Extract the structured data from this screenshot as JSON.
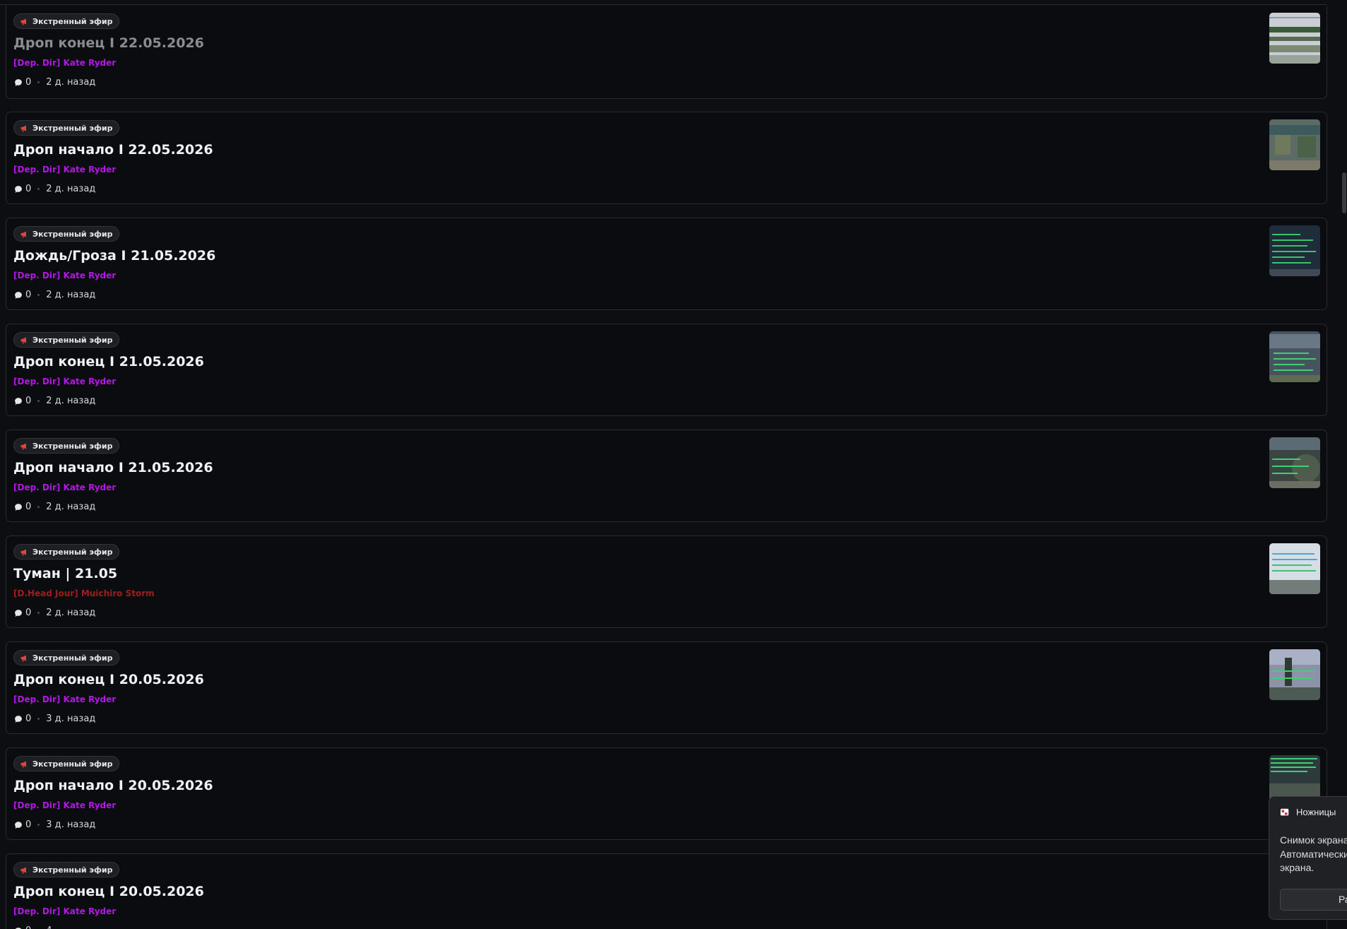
{
  "posts": [
    {
      "badge": "Экстренный эфир",
      "title": "Дроп конец I 22.05.2026",
      "author": "[Dep. Dir] Kate Ryder",
      "comments": "0",
      "time": "2 д. назад"
    },
    {
      "badge": "Экстренный эфир",
      "title": "Дроп начало I 22.05.2026",
      "author": "[Dep. Dir] Kate Ryder",
      "comments": "0",
      "time": "2 д. назад"
    },
    {
      "badge": "Экстренный эфир",
      "title": "Дождь/Гроза I 21.05.2026",
      "author": "[Dep. Dir] Kate Ryder",
      "comments": "0",
      "time": "2 д. назад"
    },
    {
      "badge": "Экстренный эфир",
      "title": "Дроп конец I 21.05.2026",
      "author": "[Dep. Dir] Kate Ryder",
      "comments": "0",
      "time": "2 д. назад"
    },
    {
      "badge": "Экстренный эфир",
      "title": "Дроп начало I 21.05.2026",
      "author": "[Dep. Dir] Kate Ryder",
      "comments": "0",
      "time": "2 д. назад"
    },
    {
      "badge": "Экстренный эфир",
      "title": "Туман | 21.05",
      "author": "[D.Head Jour] Muichiro Storm",
      "comments": "0",
      "time": "2 д. назад"
    },
    {
      "badge": "Экстренный эфир",
      "title": "Дроп конец I 20.05.2026",
      "author": "[Dep. Dir] Kate Ryder",
      "comments": "0",
      "time": "3 д. назад"
    },
    {
      "badge": "Экстренный эфир",
      "title": "Дроп начало I 20.05.2026",
      "author": "[Dep. Dir] Kate Ryder",
      "comments": "0",
      "time": "3 д. назад"
    },
    {
      "badge": "Экстренный эфир",
      "title": "Дроп конец I 20.05.2026",
      "author": "[Dep. Dir] Kate Ryder",
      "comments": "0",
      "time": "4"
    }
  ],
  "toast": {
    "app": "Ножницы",
    "line1": "Снимок экрана",
    "line2": "Автоматически",
    "line3": "экрана.",
    "button": "Ра"
  },
  "colors": {
    "author_default": "#b317e6",
    "author_alt": "#a01d1d",
    "badge_icon": "#e2463f"
  },
  "icons": {
    "badge": "megaphone-icon",
    "comments": "comment-bubble-icon",
    "toast_app": "snipping-tool-icon"
  }
}
